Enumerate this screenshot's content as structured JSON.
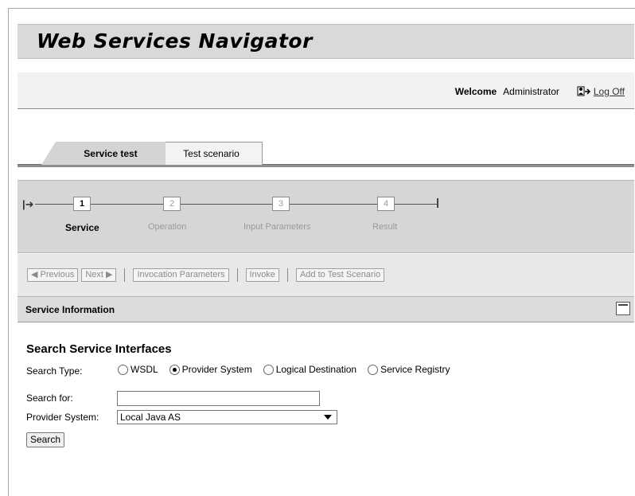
{
  "app": {
    "title": "Web Services Navigator"
  },
  "header": {
    "welcome_label": "Welcome",
    "user_name": "Administrator",
    "logoff_label": "Log Off"
  },
  "tabs": [
    {
      "label": "Service test",
      "active": true
    },
    {
      "label": "Test scenario",
      "active": false
    }
  ],
  "wizard": {
    "steps": [
      {
        "number": "1",
        "label": "Service",
        "active": true
      },
      {
        "number": "2",
        "label": "Operation",
        "active": false
      },
      {
        "number": "3",
        "label": "Input Parameters",
        "active": false
      },
      {
        "number": "4",
        "label": "Result",
        "active": false
      }
    ]
  },
  "toolbar": {
    "previous_label": "◀ Previous",
    "next_label": "Next ▶",
    "invocation_label": "Invocation Parameters",
    "invoke_label": "Invoke",
    "add_label": "Add to Test Scenario"
  },
  "section": {
    "title": "Service Information"
  },
  "search": {
    "title": "Search Service Interfaces",
    "type_label": "Search Type:",
    "options": [
      {
        "label": "WSDL",
        "checked": false
      },
      {
        "label": "Provider System",
        "checked": true
      },
      {
        "label": "Logical Destination",
        "checked": false
      },
      {
        "label": "Service Registry",
        "checked": false
      }
    ],
    "search_for_label": "Search for:",
    "search_for_value": "",
    "provider_label": "Provider System:",
    "provider_value": "Local Java AS",
    "button_label": "Search"
  }
}
